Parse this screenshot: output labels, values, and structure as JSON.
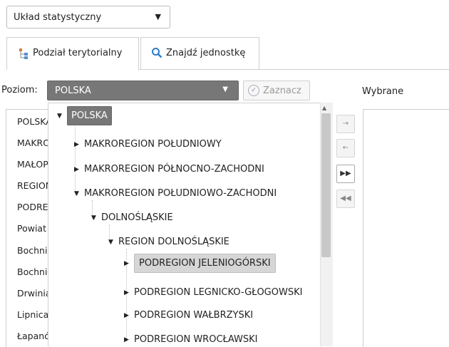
{
  "layout_select": {
    "value": "Układ statystyczny"
  },
  "tabs": [
    {
      "label": "Podział terytorialny"
    },
    {
      "label": "Znajdź jednostkę"
    }
  ],
  "level": {
    "label": "Poziom:",
    "value": "POLSKA"
  },
  "mark_button": {
    "label": "Zaznacz"
  },
  "selected_header": "Wybrane",
  "left_list": [
    "POLSKA",
    "MAKROREGION",
    "MAŁOPOLSKIE",
    "REGION",
    "PODREGION",
    "Powiat",
    "Bochnia",
    "Bochnia",
    "Drwinia",
    "Lipnica",
    "Łapanów"
  ],
  "tree": {
    "root": "POLSKA",
    "nodes": [
      {
        "label": "MAKROREGION POŁUDNIOWY",
        "expanded": false
      },
      {
        "label": "MAKROREGION PÓŁNOCNO-ZACHODNI",
        "expanded": false
      },
      {
        "label": "MAKROREGION POŁUDNIOWO-ZACHODNI",
        "expanded": true
      },
      {
        "label": "DOLNOŚLĄSKIE",
        "expanded": true
      },
      {
        "label": "REGION DOLNOŚLĄSKIE",
        "expanded": true
      },
      {
        "label": "PODREGION JELENIOGÓRSKI",
        "expanded": false,
        "highlighted": true
      },
      {
        "label": "PODREGION LEGNICKO-GŁOGOWSKI",
        "expanded": false
      },
      {
        "label": "PODREGION WAŁBRZYSKI",
        "expanded": false
      },
      {
        "label": "PODREGION WROCŁAWSKI",
        "expanded": false
      }
    ]
  },
  "icons": {
    "tab1": "territory-tree-icon",
    "tab2": "search-icon",
    "arrow_right": "→",
    "arrow_left": "←",
    "double_right": "▶▶",
    "double_left": "◀◀"
  },
  "colors": {
    "accent": "#777777",
    "search_icon": "#2a7bd3",
    "tree_icon": "#e07b39"
  }
}
